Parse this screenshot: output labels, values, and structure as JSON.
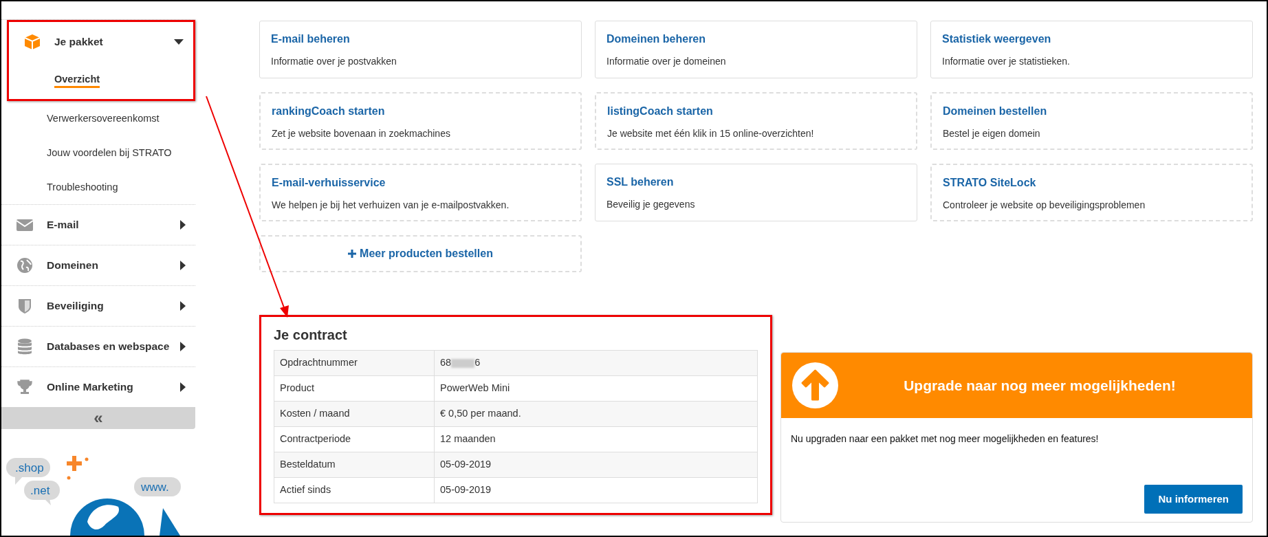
{
  "sidebar": {
    "groups": [
      {
        "label": "Je pakket",
        "expanded": true,
        "children": [
          {
            "label": "Overzicht",
            "selected": true
          },
          {
            "label": "Verwerkersovereenkomst",
            "selected": false
          },
          {
            "label": "Jouw voordelen bij STRATO",
            "selected": false
          },
          {
            "label": "Troubleshooting",
            "selected": false
          }
        ]
      },
      {
        "label": "E-mail",
        "expanded": false
      },
      {
        "label": "Domeinen",
        "expanded": false
      },
      {
        "label": "Beveiliging",
        "expanded": false
      },
      {
        "label": "Databases en webspace",
        "expanded": false
      },
      {
        "label": "Online Marketing",
        "expanded": false
      }
    ],
    "collapse_button": "«",
    "illustration": {
      "bubbles": [
        ".shop",
        ".net",
        "www."
      ]
    }
  },
  "tiles": [
    {
      "kind": "active",
      "title": "E-mail beheren",
      "description": "Informatie over je postvakken"
    },
    {
      "kind": "active",
      "title": "Domeinen beheren",
      "description": "Informatie over je domeinen"
    },
    {
      "kind": "active",
      "title": "Statistiek weergeven",
      "description": "Informatie over je statistieken."
    },
    {
      "kind": "offer",
      "title": "rankingCoach starten",
      "description": "Zet je website bovenaan in zoekmachines"
    },
    {
      "kind": "offer",
      "title": "listingCoach starten",
      "description": "Je website met één klik in 15 online-overzichten!"
    },
    {
      "kind": "offer",
      "title": "Domeinen bestellen",
      "description": "Bestel je eigen domein"
    },
    {
      "kind": "offer",
      "title": "E-mail-verhuisservice",
      "description": "We helpen je bij het verhuizen van je e-mailpostvakken."
    },
    {
      "kind": "active",
      "title": "SSL beheren",
      "description": "Beveilig je gegevens"
    },
    {
      "kind": "offer",
      "title": "STRATO SiteLock",
      "description": "Controleer je website op beveiligingsproblemen"
    },
    {
      "kind": "more",
      "title": "Meer producten bestellen"
    }
  ],
  "contract": {
    "title": "Je contract",
    "rows": [
      {
        "label": "Opdrachtnummer",
        "value": "68",
        "value_end": "6",
        "redacted": true
      },
      {
        "label": "Product",
        "value": "PowerWeb Mini"
      },
      {
        "label": "Kosten / maand",
        "value": "€ 0,50 per maand."
      },
      {
        "label": "Contractperiode",
        "value": "12 maanden"
      },
      {
        "label": "Besteldatum",
        "value": "05-09-2019"
      },
      {
        "label": "Actief sinds",
        "value": "05-09-2019"
      }
    ]
  },
  "upgrade": {
    "title": "Upgrade naar nog meer mogelijkheden!",
    "text": "Nu upgraden naar een pakket met nog meer mogelijkheden en features!",
    "button": "Nu informeren"
  }
}
